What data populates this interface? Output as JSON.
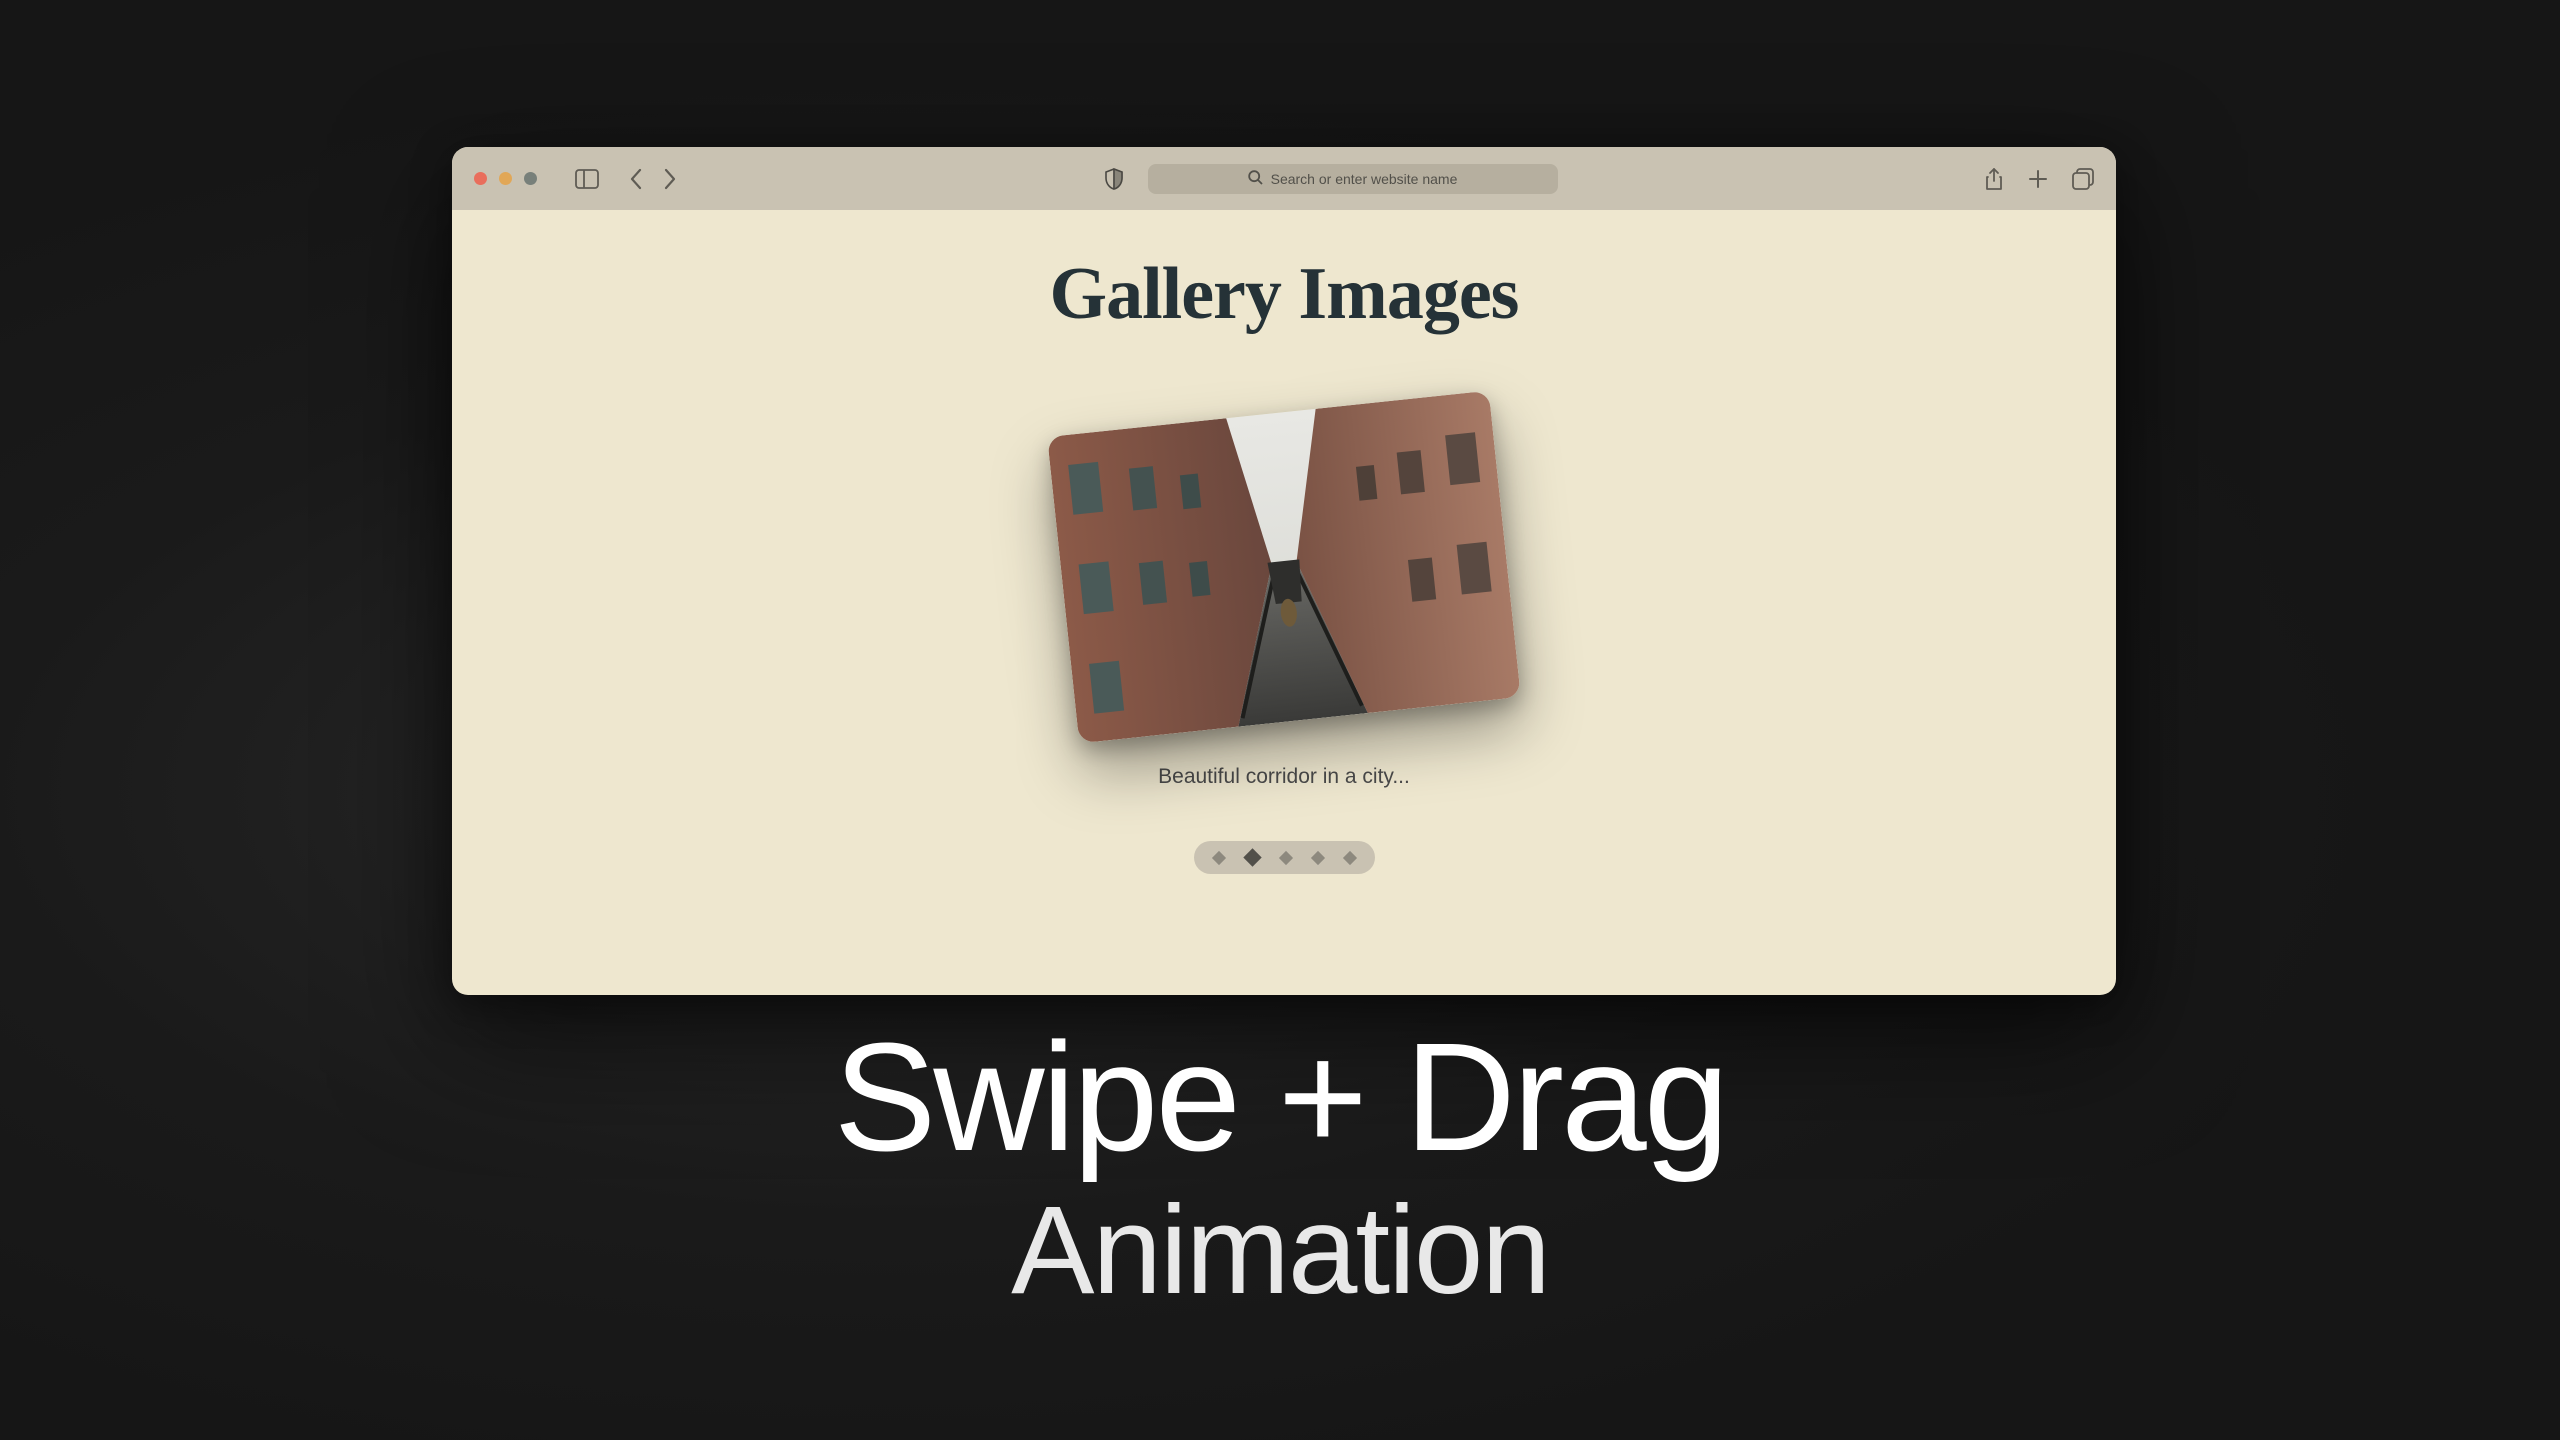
{
  "browser": {
    "addressbar_placeholder": "Search or enter website name"
  },
  "page": {
    "title": "Gallery Images",
    "caption": "Beautiful corridor in a city...",
    "pager": {
      "count": 5,
      "active_index": 1
    }
  },
  "headline": {
    "line1": "Swipe + Drag",
    "line2": "Animation"
  },
  "colors": {
    "page_bg": "#eee7cf",
    "toolbar_bg": "#c9c2b2",
    "title_color": "#253237",
    "backdrop": "#1a1a1a"
  }
}
